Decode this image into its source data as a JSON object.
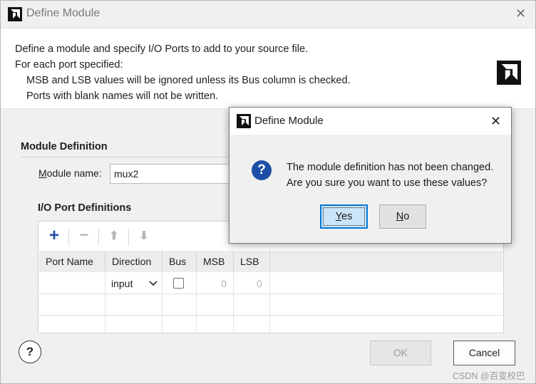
{
  "outer_dialog": {
    "title": "Define Module",
    "close_glyph": "✕",
    "description": [
      "Define a module and specify I/O Ports to add to your source file.",
      "For each port specified:",
      "MSB and LSB values will be ignored unless its Bus column is checked.",
      "Ports with blank names will not be written."
    ],
    "module_definition_heading": "Module Definition",
    "module_name_label_mnemonic": "M",
    "module_name_label_rest": "odule name:",
    "module_name_value": "mux2",
    "io_port_heading": "I/O Port Definitions",
    "toolbar": {
      "add_glyph": "+",
      "remove_glyph": "−",
      "up_glyph": "⬆",
      "down_glyph": "⬇"
    },
    "table": {
      "headers": [
        "Port Name",
        "Direction",
        "Bus",
        "MSB",
        "LSB"
      ],
      "rows": [
        {
          "port_name": "",
          "direction": "input",
          "bus": false,
          "msb": "0",
          "lsb": "0"
        }
      ]
    },
    "help_glyph": "?",
    "ok_label": "OK",
    "cancel_label": "Cancel"
  },
  "confirm_dialog": {
    "title": "Define Module",
    "close_glyph": "✕",
    "icon": "question-icon",
    "message_line1": "The module definition has not been changed.",
    "message_line2": "Are you sure you want to use these values?",
    "yes_mnemonic": "Y",
    "yes_rest": "es",
    "no_mnemonic": "N",
    "no_rest": "o"
  },
  "watermark": "CSDN @百变校巴",
  "colors": {
    "accent": "#0078d7",
    "question_icon": "#1c4fa5",
    "brand_logo": "#111111"
  }
}
